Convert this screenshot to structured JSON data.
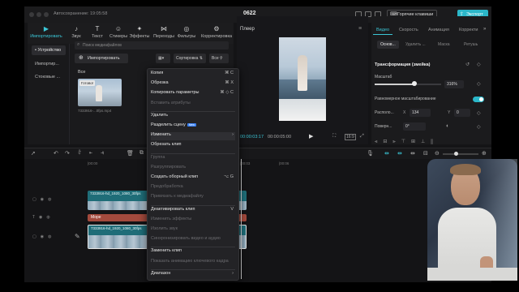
{
  "titlebar": {
    "autosave": "Автосохранение: 19:05:58",
    "project_title": "0622",
    "hotkeys_label": "Горячие клавиши",
    "export_label": "Экспорт"
  },
  "media_toolbar": {
    "tabs": [
      {
        "label": "Импортировать",
        "icon": "import-icon",
        "glyph": "▶"
      },
      {
        "label": "Звук",
        "icon": "audio-icon",
        "glyph": "♪"
      },
      {
        "label": "Текст",
        "icon": "text-icon",
        "glyph": "T"
      },
      {
        "label": "Стикеры",
        "icon": "sticker-icon",
        "glyph": "☺"
      },
      {
        "label": "Эффекты",
        "icon": "effects-icon",
        "glyph": "✦"
      },
      {
        "label": "Переходы",
        "icon": "transition-icon",
        "glyph": "⋈"
      },
      {
        "label": "Фильтры",
        "icon": "filter-icon",
        "glyph": "◎"
      },
      {
        "label": "Корректировка",
        "icon": "adjust-icon",
        "glyph": "⚙"
      }
    ]
  },
  "media_panel": {
    "side_items": [
      "• Устройство",
      "Импортир...",
      "Стоковые ..."
    ],
    "search_placeholder": "Поиск медиафайлов",
    "import_label": "Импортировать",
    "sort_label": "Сортировка",
    "all_filter_label": "Все",
    "section_label": "Все",
    "thumb_badge": "Готово!",
    "thumb_caption": "7333916-...0fps.mp4"
  },
  "player": {
    "title": "Плеер",
    "time_current": "00:00:03:17",
    "time_total": "00:00:05:00"
  },
  "inspector": {
    "tabs": [
      "Видео",
      "Скорость",
      "Анимация",
      "Корректи"
    ],
    "subtabs": [
      "Основ...",
      "Удалить ...",
      "Маска",
      "Ретушь"
    ],
    "section_title": "Трансформация (змейка)",
    "scale_label": "Масштаб",
    "scale_value": "316%",
    "scale_fraction": 0.6,
    "uniform_label": "Равномерное масштабирование",
    "position_label": "Располо...",
    "pos_x_label": "X",
    "pos_x": "134",
    "pos_y_label": "Y",
    "pos_y": "0",
    "rotate_label": "Поверн...",
    "rotate_value": "0°"
  },
  "timeline": {
    "ruler": [
      "|00:00",
      "|00:03",
      "|00:06"
    ],
    "video_clip_label": "7333916-hd_1920_1080_30fps",
    "text_clip_label": "Море",
    "main_clip_label": "7333916-hd_1920_1080_30fps"
  },
  "context_menu": {
    "items": [
      {
        "label": "Копия",
        "shortcut": "⌘ C",
        "disabled": false
      },
      {
        "label": "Обрезка",
        "shortcut": "⌘ X",
        "disabled": false
      },
      {
        "label": "Копировать параметры",
        "shortcut": "⌘ ◇ C",
        "disabled": false
      },
      {
        "label": "Вставить атрибуты",
        "shortcut": "",
        "disabled": true
      },
      {
        "label": "Удалить",
        "shortcut": "",
        "disabled": false
      },
      {
        "label": "Разделить сцену",
        "shortcut": "",
        "disabled": false,
        "badge": "New"
      },
      {
        "label": "Изменить",
        "shortcut": "›",
        "disabled": false
      },
      {
        "label": "Обрезать клип",
        "shortcut": "",
        "disabled": false
      },
      {
        "label": "Группа",
        "shortcut": "",
        "disabled": true
      },
      {
        "label": "Разгруппировать",
        "shortcut": "",
        "disabled": true
      },
      {
        "label": "Создать оборный клип",
        "shortcut": "⌥ G",
        "disabled": false
      },
      {
        "label": "Предобработка",
        "shortcut": "",
        "disabled": true
      },
      {
        "label": "Привязать к медиафайлу",
        "shortcut": "",
        "disabled": true
      },
      {
        "label": "Деактивировать клип",
        "shortcut": "V",
        "disabled": false
      },
      {
        "label": "Изменить эффекты",
        "shortcut": "",
        "disabled": true
      },
      {
        "label": "Изолить звук",
        "shortcut": "",
        "disabled": true
      },
      {
        "label": "Синхронизировать видео и аудио",
        "shortcut": "",
        "disabled": true
      },
      {
        "label": "Заменить клип",
        "shortcut": "",
        "disabled": false
      },
      {
        "label": "Показать анимацию ключевого кадра",
        "shortcut": "",
        "disabled": true
      },
      {
        "label": "Диапазон",
        "shortcut": "›",
        "disabled": false
      }
    ]
  },
  "colors": {
    "accent": "#2bb7c9",
    "clip": "#1f6d78",
    "text_clip": "#a34a3d"
  }
}
